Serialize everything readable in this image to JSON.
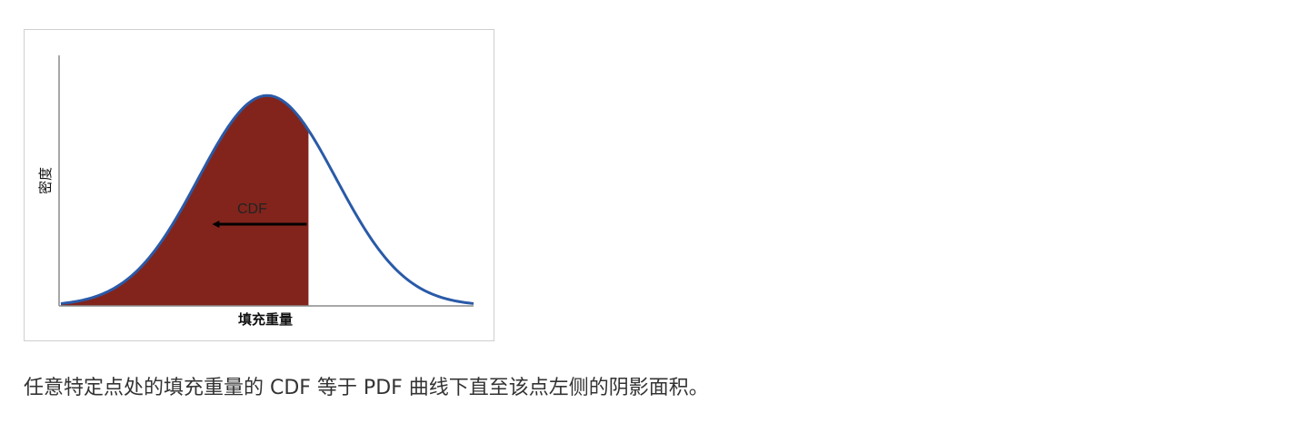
{
  "chart_data": {
    "type": "area",
    "xlabel": "填充重量",
    "ylabel": "密度",
    "annotation": "CDF",
    "x": [
      -3.0,
      -2.5,
      -2.0,
      -1.5,
      -1.0,
      -0.5,
      0.0,
      0.5,
      1.0,
      1.5,
      2.0,
      2.5,
      3.0
    ],
    "y": [
      0.004,
      0.018,
      0.054,
      0.13,
      0.242,
      0.352,
      0.399,
      0.352,
      0.242,
      0.13,
      0.054,
      0.018,
      0.004
    ],
    "shaded_to_x": 0.6,
    "xlim": [
      -3.0,
      3.0
    ],
    "ylim": [
      0,
      0.42
    ],
    "grid": false,
    "colors": {
      "curve": "#2a5aa8",
      "shade": "#82241c",
      "axis": "#8a8a8a",
      "arrow": "#000000"
    }
  },
  "caption": "任意特定点处的填充重量的 CDF 等于 PDF 曲线下直至该点左侧的阴影面积。"
}
